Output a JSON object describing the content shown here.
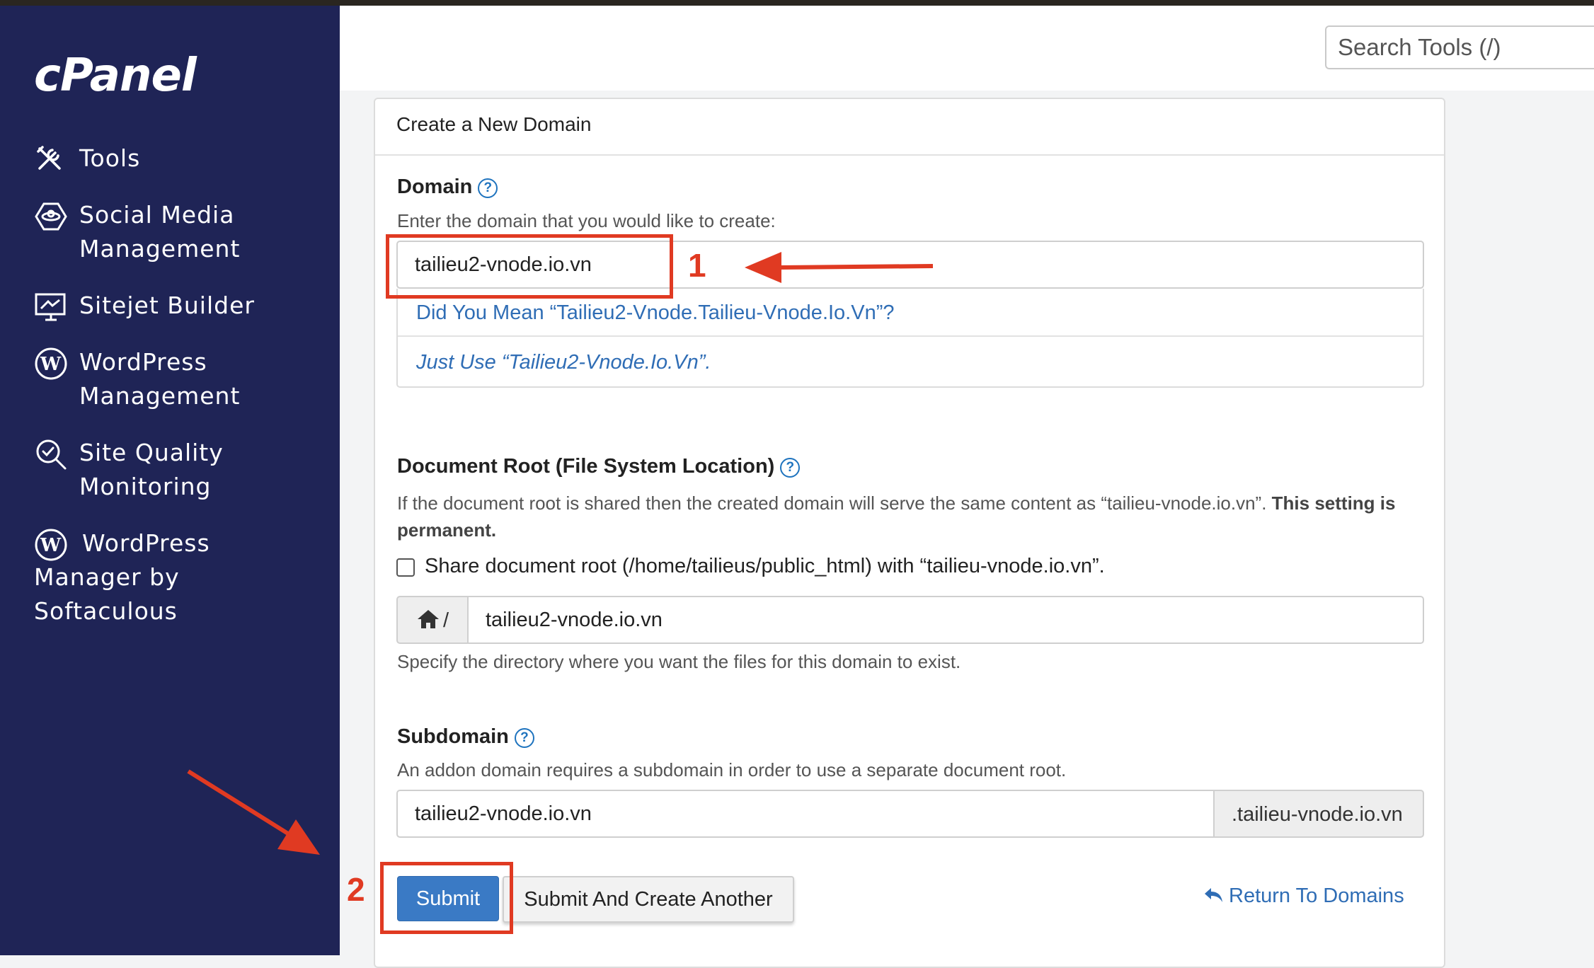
{
  "sidebar": {
    "logo": "cPanel",
    "items": [
      {
        "label": "Tools",
        "icon": "tools-icon"
      },
      {
        "label": "Social Media Management",
        "icon": "social-media-icon"
      },
      {
        "label": "Sitejet Builder",
        "icon": "sitejet-icon"
      },
      {
        "label": "WordPress Management",
        "icon": "wordpress-icon"
      },
      {
        "label": "Site Quality Monitoring",
        "icon": "site-quality-icon"
      },
      {
        "label": "WordPress Manager by Softaculous",
        "icon": "wordpress-icon"
      }
    ]
  },
  "header": {
    "search_placeholder": "Search Tools (/)"
  },
  "panel": {
    "title": "Create a New Domain",
    "domain": {
      "label": "Domain",
      "help": "?",
      "description": "Enter the domain that you would like to create:",
      "value": "tailieu2-vnode.io.vn",
      "suggestions": [
        "Did You Mean “Tailieu2-Vnode.Tailieu-Vnode.Io.Vn”?",
        "Just Use “Tailieu2-Vnode.Io.Vn”."
      ]
    },
    "docroot": {
      "label": "Document Root (File System Location)",
      "help": "?",
      "description": "If the document root is shared then the created domain will serve the same content as “tailieu-vnode.io.vn”.",
      "description_bold": "This setting is permanent.",
      "checkbox_label": "Share document root (/home/tailieus/public_html) with “tailieu-vnode.io.vn”.",
      "checkbox_checked": false,
      "prefix": "/",
      "value": "tailieu2-vnode.io.vn",
      "hint": "Specify the directory where you want the files for this domain to exist."
    },
    "subdomain": {
      "label": "Subdomain",
      "help": "?",
      "description": "An addon domain requires a subdomain in order to use a separate document root.",
      "value": "tailieu2-vnode.io.vn",
      "suffix": ".tailieu-vnode.io.vn"
    },
    "buttons": {
      "submit": "Submit",
      "submit_another": "Submit And Create Another",
      "return": "Return To Domains"
    }
  },
  "annotations": {
    "step1": "1",
    "step2": "2",
    "color": "#e03a22"
  },
  "colors": {
    "sidebar": "#1f2456",
    "primary": "#3a7ac5",
    "link": "#2f6db5"
  }
}
